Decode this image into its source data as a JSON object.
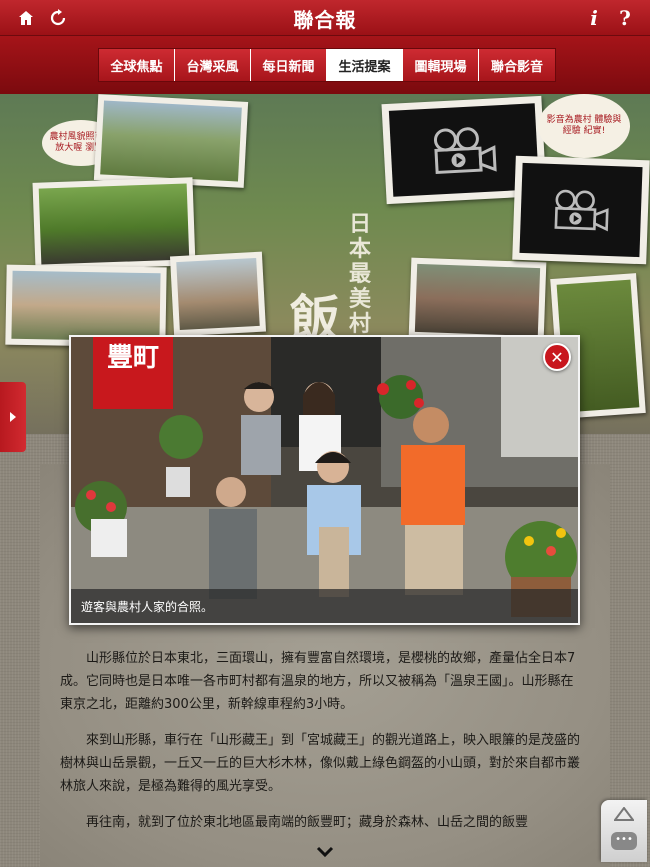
{
  "header": {
    "logo": "聯合報",
    "icons": {
      "home": "home-icon",
      "refresh": "refresh-icon",
      "info": "i",
      "help": "?"
    }
  },
  "tabs": [
    {
      "label": "全球焦點",
      "active": false
    },
    {
      "label": "台灣采風",
      "active": false
    },
    {
      "label": "每日新聞",
      "active": false
    },
    {
      "label": "生活提案",
      "active": true
    },
    {
      "label": "圖輯現場",
      "active": false
    },
    {
      "label": "聯合影音",
      "active": false
    }
  ],
  "hero": {
    "vertical_subtitle": "日本最美村落",
    "big_title": "飯豐町",
    "bubble_left": "農村風貌照可以放大喔 瀏覽!",
    "bubble_right": "影音為農村 體驗與經驗 紀實!"
  },
  "overlay": {
    "sign": "豐町",
    "caption": "遊客與農村人家的合照。",
    "close": "✕"
  },
  "article": {
    "p1": "山形縣位於日本東北，三面環山，擁有豐富自然環境，是櫻桃的故鄉，產量佔全日本7成。它同時也是日本唯一各市町村都有溫泉的地方，所以又被稱為「溫泉王國」。山形縣在東京之北，距離約300公里，新幹線車程約3小時。",
    "p2": "來到山形縣，車行在「山形藏王」到「宮城藏王」的觀光道路上，映入眼簾的是茂盛的樹林與山岳景觀，一丘又一丘的巨大杉木林，像似戴上綠色鋼盔的小山頭，對於來自都市叢林旅人來說，是極為難得的風光享受。",
    "p3": "再往南，就到了位於東北地區最南端的飯豐町；藏身於森林、山岳之間的飯豐"
  },
  "colors": {
    "brand_red": "#b5171d",
    "active_tab": "#ffffff"
  }
}
